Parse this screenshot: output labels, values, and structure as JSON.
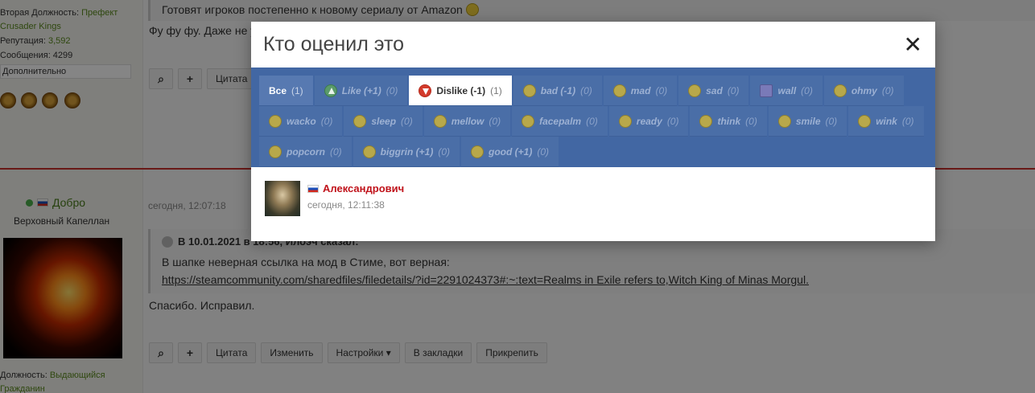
{
  "background": {
    "user1": {
      "line1": "Вторая Должность:",
      "line1_value": "Префект",
      "line2": "Crusader Kings",
      "reputation_label": "Репутация:",
      "reputation_value": "3,592",
      "messages": "Сообщения: 4299",
      "more": "Дополнительно"
    },
    "post1": {
      "quote_text": "Готовят игроков постепенно к новому сериалу от Amazon",
      "reply_text": "Фу фу фу. Даже не у",
      "quote_button": "Цитата"
    },
    "user2": {
      "name": "Добро",
      "rank": "Верховный Капеллан",
      "role_label": "Должность:",
      "role_value": "Выдающийся",
      "role_value2": "Гражданин"
    },
    "post2": {
      "date": "сегодня, 12:07:18",
      "quote_header": "В 10.01.2021 в 18:56, Илоэч сказал:",
      "quote_text": "В шапке неверная ссылка на мод в Стиме, вот верная:",
      "quote_link": "https://steamcommunity.com/sharedfiles/filedetails/?id=2291024373#:~:text=Realms in Exile refers to,Witch King of Minas Morgul.",
      "reply_text": "Спасибо. Исправил.",
      "buttons": {
        "quote": "Цитата",
        "edit": "Изменить",
        "settings": "Настройки ▾",
        "bookmarks": "В закладки",
        "pin": "Прикрепить"
      }
    }
  },
  "modal": {
    "title": "Кто оценил это",
    "close_glyph": "✕",
    "tabs": [
      {
        "label": "Все",
        "count": "(1)"
      },
      {
        "label": "Like (+1)",
        "count": "(0)"
      },
      {
        "label": "Dislike (-1)",
        "count": "(1)"
      },
      {
        "label": "bad (-1)",
        "count": "(0)"
      },
      {
        "label": "mad",
        "count": "(0)"
      },
      {
        "label": "sad",
        "count": "(0)"
      },
      {
        "label": "wall",
        "count": "(0)"
      },
      {
        "label": "ohmy",
        "count": "(0)"
      },
      {
        "label": "wacko",
        "count": "(0)"
      },
      {
        "label": "sleep",
        "count": "(0)"
      },
      {
        "label": "mellow",
        "count": "(0)"
      },
      {
        "label": "facepalm",
        "count": "(0)"
      },
      {
        "label": "ready",
        "count": "(0)"
      },
      {
        "label": "think",
        "count": "(0)"
      },
      {
        "label": "smile",
        "count": "(0)"
      },
      {
        "label": "wink",
        "count": "(0)"
      },
      {
        "label": "popcorn",
        "count": "(0)"
      },
      {
        "label": "biggrin (+1)",
        "count": "(0)"
      },
      {
        "label": "good (+1)",
        "count": "(0)"
      }
    ],
    "voters": [
      {
        "name": "Александрович",
        "time": "сегодня, 12:11:38"
      }
    ]
  },
  "colors": {
    "tab_bar": "#4267a3",
    "voter_name": "#c0121a",
    "separator": "#c9302c"
  }
}
